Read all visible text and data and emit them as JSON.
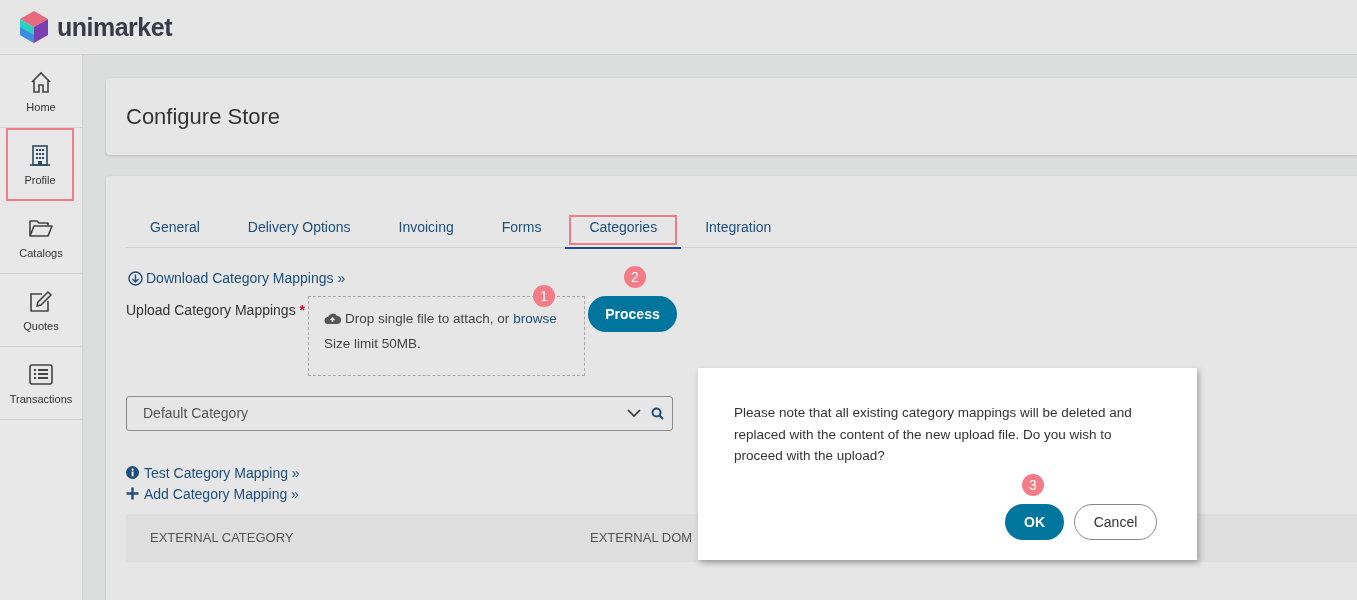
{
  "logo": {
    "text": "unimarket"
  },
  "sidebar": {
    "items": [
      {
        "label": "Home",
        "kind": "home",
        "highlighted": false
      },
      {
        "label": "Profile",
        "kind": "building",
        "highlighted": true
      },
      {
        "label": "Catalogs",
        "kind": "folder",
        "highlighted": false
      },
      {
        "label": "Quotes",
        "kind": "edit",
        "highlighted": false
      },
      {
        "label": "Transactions",
        "kind": "list",
        "highlighted": false
      }
    ]
  },
  "page_title": "Configure Store",
  "tabs": [
    {
      "label": "General",
      "selected": false,
      "highlighted": false
    },
    {
      "label": "Delivery Options",
      "selected": false,
      "highlighted": false
    },
    {
      "label": "Invoicing",
      "selected": false,
      "highlighted": false
    },
    {
      "label": "Forms",
      "selected": false,
      "highlighted": false
    },
    {
      "label": "Categories",
      "selected": true,
      "highlighted": true
    },
    {
      "label": "Integration",
      "selected": false,
      "highlighted": false
    }
  ],
  "download_link": "Download Category Mappings »",
  "upload": {
    "label": "Upload Category Mappings",
    "required_mark": "*",
    "drop_text": "Drop single file to attach, or",
    "browse_link": "browse",
    "size_limit": "Size limit 50MB.",
    "callout": "1"
  },
  "process_button": {
    "label": "Process",
    "callout": "2"
  },
  "category_select": {
    "value": "Default Category"
  },
  "links": [
    {
      "kind": "info",
      "label": "Test Category Mapping »"
    },
    {
      "kind": "add",
      "label": "Add Category Mapping »"
    }
  ],
  "table": {
    "columns": [
      "EXTERNAL CATEGORY",
      "EXTERNAL DOM"
    ]
  },
  "dialog": {
    "message": "Please note that all existing category mappings will be deleted and replaced with the content of the new upload file. Do you wish to proceed with the upload?",
    "buttons": [
      {
        "label": "OK",
        "kind": "primary",
        "callout": "3"
      },
      {
        "label": "Cancel",
        "kind": "secondary"
      }
    ]
  }
}
